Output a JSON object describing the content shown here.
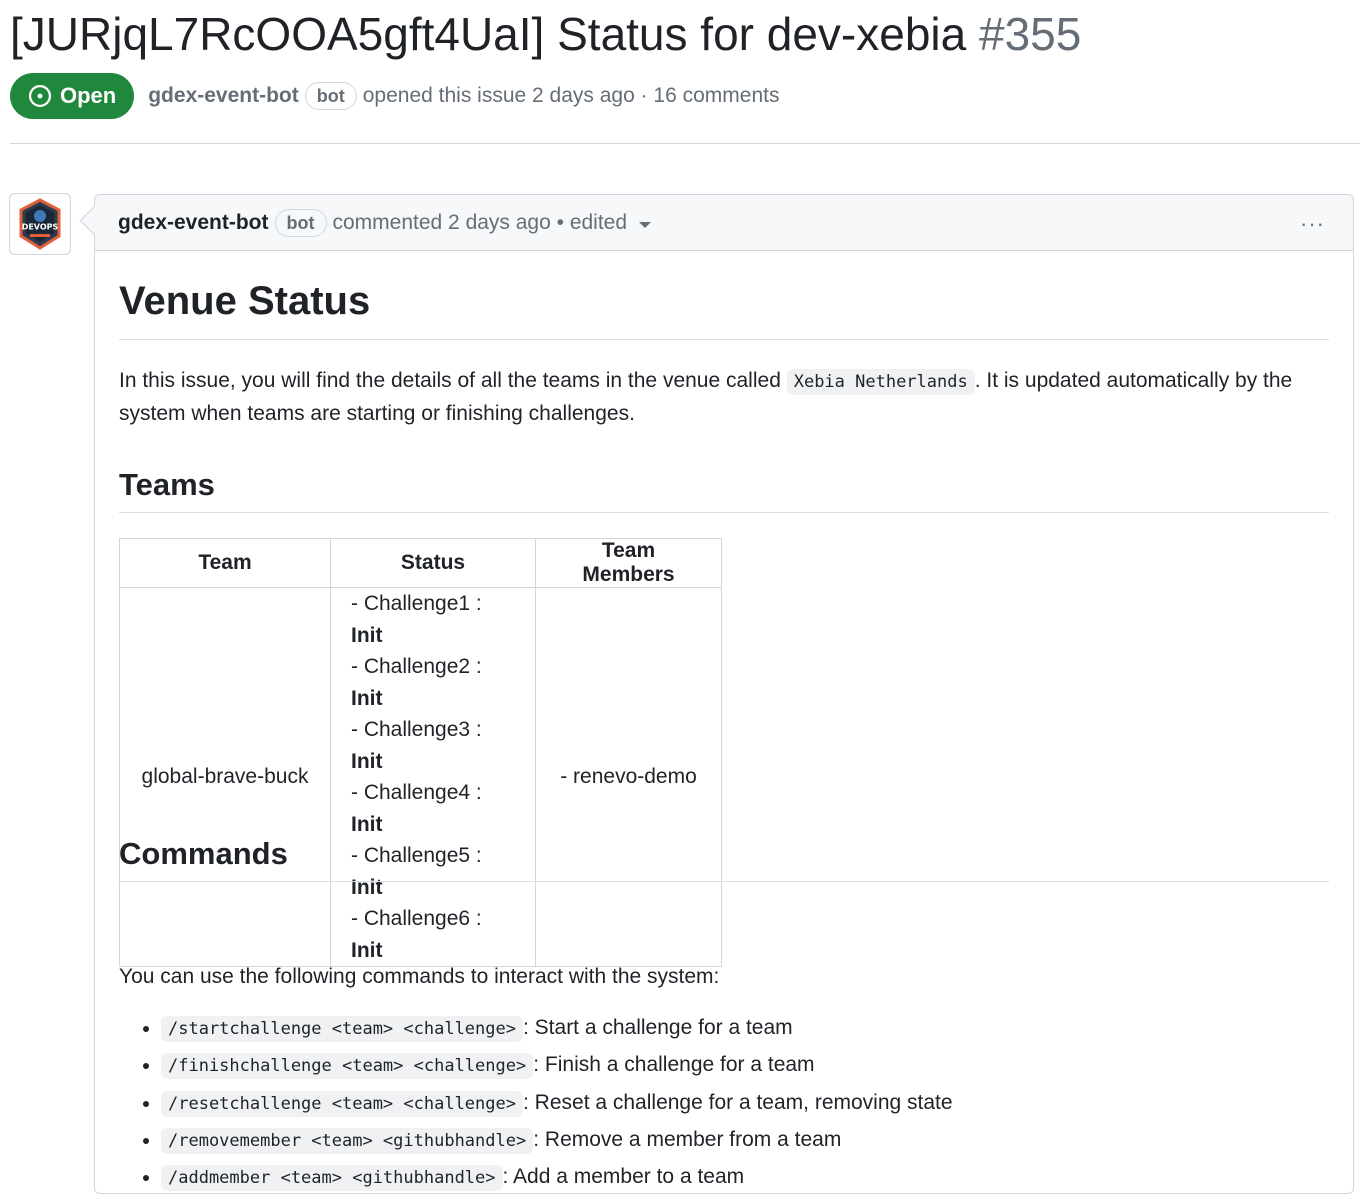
{
  "issue": {
    "title": "[JURjqL7RcOOA5gft4UaI] Status for dev-xebia",
    "number": "#355",
    "state": "Open",
    "author": "gdex-event-bot",
    "author_badge": "bot",
    "meta": "opened this issue 2 days ago · 16 comments"
  },
  "comment": {
    "author": "gdex-event-bot",
    "author_badge": "bot",
    "meta": "commented 2 days ago • edited",
    "menu_label": "···",
    "avatar_text": "DEVOPS"
  },
  "body": {
    "heading": "Venue Status",
    "intro_before": "In this issue, you will find the details of all the teams in the venue called",
    "venue_code": "Xebia Netherlands",
    "intro_after": ". It is updated automatically by the system when teams are starting or finishing challenges.",
    "teams_heading": "Teams",
    "table": {
      "headers": [
        "Team",
        "Status",
        "Team Members"
      ],
      "rows": [
        {
          "team": "global-brave-buck",
          "challenges": [
            {
              "name": "- Challenge1 : ",
              "status": "Init"
            },
            {
              "name": "- Challenge2 : ",
              "status": "Init"
            },
            {
              "name": "- Challenge3 : ",
              "status": "Init"
            },
            {
              "name": "- Challenge4 : ",
              "status": "Init"
            },
            {
              "name": "- Challenge5 : ",
              "status": "Init"
            },
            {
              "name": "- Challenge6 : ",
              "status": "Init"
            }
          ],
          "members": "- renevo-demo"
        }
      ]
    },
    "commands_heading": "Commands",
    "commands_intro": "You can use the following commands to interact with the system:",
    "commands": [
      {
        "code": "/startchallenge <team> <challenge>",
        "desc": ": Start a challenge for a team"
      },
      {
        "code": "/finishchallenge <team> <challenge>",
        "desc": ": Finish a challenge for a team"
      },
      {
        "code": "/resetchallenge <team> <challenge>",
        "desc": ": Reset a challenge for a team, removing state"
      },
      {
        "code": "/removemember <team> <githubhandle>",
        "desc": ": Remove a member from a team"
      },
      {
        "code": "/addmember <team> <githubhandle>",
        "desc": ": Add a member to a team"
      }
    ]
  },
  "colors": {
    "open_green": "#1f883d",
    "muted": "#656d76",
    "border": "#d0d7de"
  }
}
